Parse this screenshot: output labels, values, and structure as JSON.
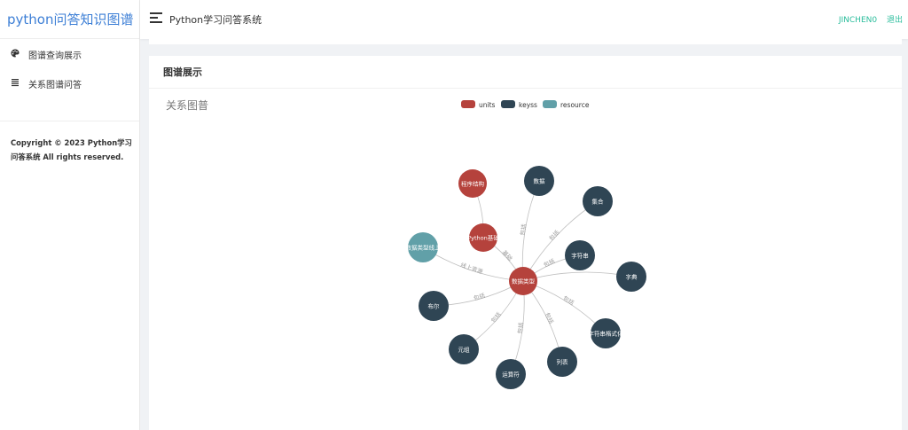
{
  "logo": "python问答知识图谱",
  "sidebar": {
    "items": [
      {
        "label": "图谱查询展示",
        "icon": "palette-icon"
      },
      {
        "label": "关系图谱问答",
        "icon": "list-icon"
      }
    ],
    "copyright": "Copyright © 2023 Python学习问答系统 All rights reserved."
  },
  "header": {
    "title": "Python学习问答系统",
    "user": "JINCHEN0",
    "logout": "退出"
  },
  "card": {
    "title": "图谱展示"
  },
  "chart_data": {
    "type": "graph",
    "title": "关系图普",
    "legend": [
      {
        "name": "units",
        "color": "#b5423c"
      },
      {
        "name": "keyss",
        "color": "#2f4554"
      },
      {
        "name": "resource",
        "color": "#61a0a8"
      }
    ],
    "nodes": [
      {
        "name": "数据类型",
        "category": "units"
      },
      {
        "name": "Python基础",
        "category": "units"
      },
      {
        "name": "程序结构",
        "category": "units"
      },
      {
        "name": "数据",
        "category": "keyss"
      },
      {
        "name": "集合",
        "category": "keyss"
      },
      {
        "name": "字符串",
        "category": "keyss"
      },
      {
        "name": "字典",
        "category": "keyss"
      },
      {
        "name": "字符串格式化",
        "category": "keyss"
      },
      {
        "name": "列表",
        "category": "keyss"
      },
      {
        "name": "运算符",
        "category": "keyss"
      },
      {
        "name": "元组",
        "category": "keyss"
      },
      {
        "name": "布尔",
        "category": "keyss"
      },
      {
        "name": "数据类型线上",
        "category": "resource"
      }
    ],
    "links": [
      {
        "source": "程序结构",
        "target": "Python基础",
        "label": ""
      },
      {
        "source": "Python基础",
        "target": "数据类型",
        "label": "基础"
      },
      {
        "source": "数据类型",
        "target": "数据",
        "label": "包括"
      },
      {
        "source": "数据类型",
        "target": "集合",
        "label": "包括"
      },
      {
        "source": "数据类型",
        "target": "字符串",
        "label": "包括"
      },
      {
        "source": "数据类型",
        "target": "字典",
        "label": ""
      },
      {
        "source": "数据类型",
        "target": "字符串格式化",
        "label": "包括"
      },
      {
        "source": "数据类型",
        "target": "列表",
        "label": "包括"
      },
      {
        "source": "数据类型",
        "target": "运算符",
        "label": "包括"
      },
      {
        "source": "数据类型",
        "target": "元组",
        "label": "包括"
      },
      {
        "source": "数据类型",
        "target": "布尔",
        "label": "包括"
      },
      {
        "source": "数据类型",
        "target": "数据类型线上",
        "label": "线上资源"
      }
    ]
  }
}
